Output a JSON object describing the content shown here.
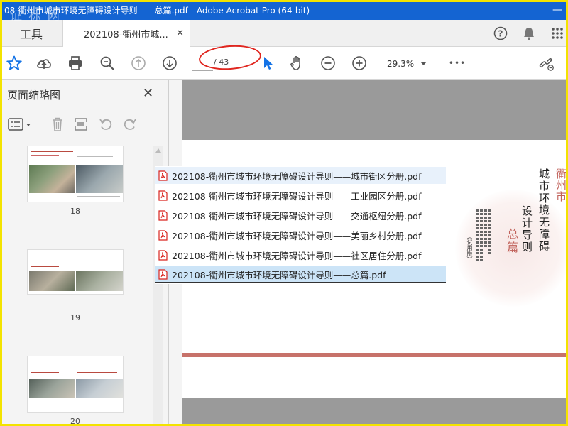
{
  "window": {
    "title": "08-衢州市城市环境无障碍设计导则——总篇.pdf - Adobe Acrobat Pro (64-bit)",
    "watermark": "证 标 网"
  },
  "tabs": {
    "tools_label": "工具",
    "doc_tab_label": "202108-衢州市城...",
    "close_glyph": "×"
  },
  "toolbar": {
    "page_current": "",
    "page_count": "/ 43",
    "zoom": "29.3%",
    "more": "•••"
  },
  "left_panel": {
    "title": "页面缩略图",
    "close_glyph": "✕",
    "thumbnails": [
      {
        "label": "18"
      },
      {
        "label": "19"
      },
      {
        "label": "20"
      }
    ]
  },
  "file_list": {
    "items": [
      {
        "name": "202108-衢州市城市环境无障碍设计导则——城市街区分册.pdf",
        "state": "hover"
      },
      {
        "name": "202108-衢州市城市环境无障碍设计导则——工业园区分册.pdf",
        "state": "normal"
      },
      {
        "name": "202108-衢州市城市环境无障碍设计导则——交通枢纽分册.pdf",
        "state": "normal"
      },
      {
        "name": "202108-衢州市城市环境无障碍设计导则——美丽乡村分册.pdf",
        "state": "normal"
      },
      {
        "name": "202108-衢州市城市环境无障碍设计导则——社区居住分册.pdf",
        "state": "normal"
      },
      {
        "name": "202108-衢州市城市环境无障碍设计导则——总篇.pdf",
        "state": "selected"
      }
    ]
  },
  "document_cover": {
    "city_red": "衢州市",
    "title_line1": "城市环境无障碍",
    "title_line2": "设计导则",
    "subtitle": "总篇",
    "small_note": "（试用版）"
  },
  "colors": {
    "titlebar": "#1464d2",
    "frame": "#f3e300",
    "annotation": "#e0261f",
    "cover_red": "#c1615a",
    "pdf_icon": "#d9231d"
  }
}
